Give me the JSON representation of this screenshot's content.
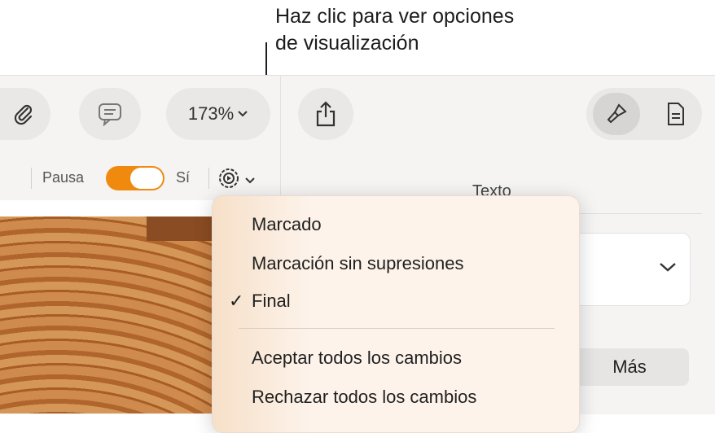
{
  "callout": {
    "line1": "Haz clic para ver opciones",
    "line2": "de visualización"
  },
  "toolbar": {
    "zoom_label": "173%",
    "buttons": [
      "attachment-icon",
      "comment-icon",
      "zoom-popup",
      "share-icon",
      "format-brush-icon",
      "document-icon"
    ]
  },
  "tracking": {
    "pause_label": "Pausa",
    "on_label": "Sí",
    "toggle_on": true,
    "accent_color": "#f08a0f"
  },
  "sidebar": {
    "tab_label": "Texto",
    "more_button": "Más"
  },
  "menu": {
    "items": [
      {
        "label": "Marcado",
        "checked": false
      },
      {
        "label": "Marcación sin supresiones",
        "checked": false
      },
      {
        "label": "Final",
        "checked": true
      },
      {
        "label": "Aceptar todos los cambios",
        "checked": false
      },
      {
        "label": "Rechazar todos los cambios",
        "checked": false
      }
    ],
    "check_glyph": "✓"
  }
}
